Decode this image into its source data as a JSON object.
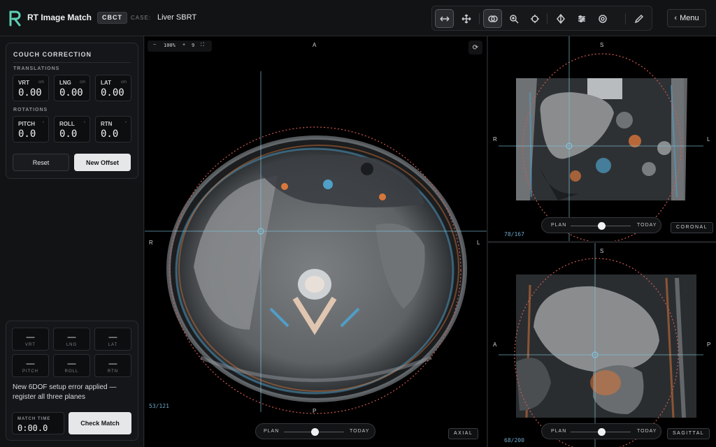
{
  "header": {
    "app_title": "RT Image Match",
    "modality": "CBCT",
    "case_label": "CASE:",
    "case_name": "Liver SBRT",
    "menu_label": "Menu"
  },
  "toolbar": {
    "tools": [
      "horizontal-arrows-icon",
      "move-icon",
      "overlay-icon",
      "zoom-icon",
      "crosshair-icon",
      "target-icon",
      "sliders-icon",
      "roi-icon",
      "pencil-icon"
    ]
  },
  "couch": {
    "title": "COUCH CORRECTION",
    "translations_label": "TRANSLATIONS",
    "rotations_label": "ROTATIONS",
    "translations": [
      {
        "label": "VRT",
        "unit": "cm",
        "value": "0.00"
      },
      {
        "label": "LNG",
        "unit": "cm",
        "value": "0.00"
      },
      {
        "label": "LAT",
        "unit": "cm",
        "value": "0.00"
      }
    ],
    "rotations": [
      {
        "label": "PITCH",
        "unit": "°",
        "value": "0.0"
      },
      {
        "label": "ROLL",
        "unit": "°",
        "value": "0.0"
      },
      {
        "label": "RTN",
        "unit": "°",
        "value": "0.0"
      }
    ],
    "reset_label": "Reset",
    "new_offset_label": "New Offset"
  },
  "match": {
    "stats": [
      {
        "label": "VRT",
        "value": "—"
      },
      {
        "label": "LNG",
        "value": "—"
      },
      {
        "label": "LAT",
        "value": "—"
      },
      {
        "label": "PITCH",
        "value": "—"
      },
      {
        "label": "ROLL",
        "value": "—"
      },
      {
        "label": "RTN",
        "value": "—"
      }
    ],
    "message": "New 6DOF setup error applied — register all three planes",
    "match_time_label": "MATCH TIME",
    "match_time": "0:00.0",
    "check_label": "Check Match"
  },
  "axial": {
    "zoom": "100%",
    "zoom_minus": "−",
    "zoom_plus": "+",
    "zoom_extra": "9",
    "orient_top": "A",
    "orient_bottom": "P",
    "orient_left": "R",
    "orient_right": "L",
    "slice": "53/121",
    "plan_label": "PLAN",
    "today_label": "TODAY",
    "blend": 0.52,
    "tag": "AXIAL"
  },
  "coronal": {
    "orient_top": "S",
    "orient_left": "R",
    "orient_right": "L",
    "slice": "78/167",
    "plan_label": "PLAN",
    "today_label": "TODAY",
    "blend": 0.52,
    "tag": "CORONAL"
  },
  "sagittal": {
    "orient_top": "S",
    "orient_left": "A",
    "orient_right": "P",
    "slice": "68/200",
    "plan_label": "PLAN",
    "today_label": "TODAY",
    "blend": 0.52,
    "tag": "SAGITTAL"
  },
  "colors": {
    "plan": "#4f9fc8",
    "today": "#d9773a",
    "crosshair": "#7fc4dd",
    "ptv_ring": "#d05a50"
  }
}
